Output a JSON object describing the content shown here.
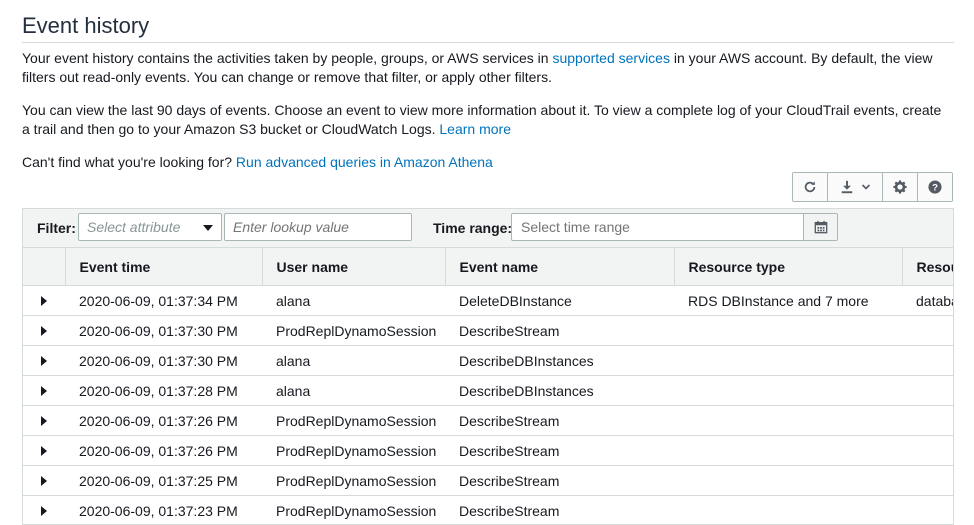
{
  "page": {
    "title": "Event history"
  },
  "intro": {
    "p1_before": "Your event history contains the activities taken by people, groups, or AWS services in ",
    "p1_link": "supported services",
    "p1_after": " in your AWS account. By default, the view filters out read-only events. You can change or remove that filter, or apply other filters.",
    "p2_before": "You can view the last 90 days of events. Choose an event to view more information about it. To view a complete log of your CloudTrail events, create a trail and then go to your Amazon S3 bucket or CloudWatch Logs. ",
    "p2_link": "Learn more",
    "p3_before": "Can't find what you're looking for? ",
    "p3_link": "Run advanced queries in Amazon Athena"
  },
  "toolbar": {
    "refresh_icon": "refresh-icon",
    "download_icon": "download-icon",
    "settings_icon": "gear-icon",
    "help_icon": "help-icon"
  },
  "filter": {
    "label": "Filter:",
    "attribute_placeholder": "Select attribute",
    "lookup_placeholder": "Enter lookup value",
    "time_label": "Time range:",
    "time_placeholder": "Select time range"
  },
  "table": {
    "columns": [
      "Event time",
      "User name",
      "Event name",
      "Resource type",
      "Resou"
    ],
    "rows": [
      {
        "time": "2020-06-09, 01:37:34 PM",
        "user": "alana",
        "event": "DeleteDBInstance",
        "rtype": "RDS DBInstance and 7 more",
        "resource": "databa"
      },
      {
        "time": "2020-06-09, 01:37:30 PM",
        "user": "ProdReplDynamoSession",
        "event": "DescribeStream",
        "rtype": "",
        "resource": ""
      },
      {
        "time": "2020-06-09, 01:37:30 PM",
        "user": "alana",
        "event": "DescribeDBInstances",
        "rtype": "",
        "resource": ""
      },
      {
        "time": "2020-06-09, 01:37:28 PM",
        "user": "alana",
        "event": "DescribeDBInstances",
        "rtype": "",
        "resource": ""
      },
      {
        "time": "2020-06-09, 01:37:26 PM",
        "user": "ProdReplDynamoSession",
        "event": "DescribeStream",
        "rtype": "",
        "resource": ""
      },
      {
        "time": "2020-06-09, 01:37:26 PM",
        "user": "ProdReplDynamoSession",
        "event": "DescribeStream",
        "rtype": "",
        "resource": ""
      },
      {
        "time": "2020-06-09, 01:37:25 PM",
        "user": "ProdReplDynamoSession",
        "event": "DescribeStream",
        "rtype": "",
        "resource": ""
      },
      {
        "time": "2020-06-09, 01:37:23 PM",
        "user": "ProdReplDynamoSession",
        "event": "DescribeStream",
        "rtype": "",
        "resource": ""
      }
    ]
  },
  "colors": {
    "link": "#0073bb",
    "header_bg": "#f2f3f3",
    "border": "#d5dbdb"
  }
}
